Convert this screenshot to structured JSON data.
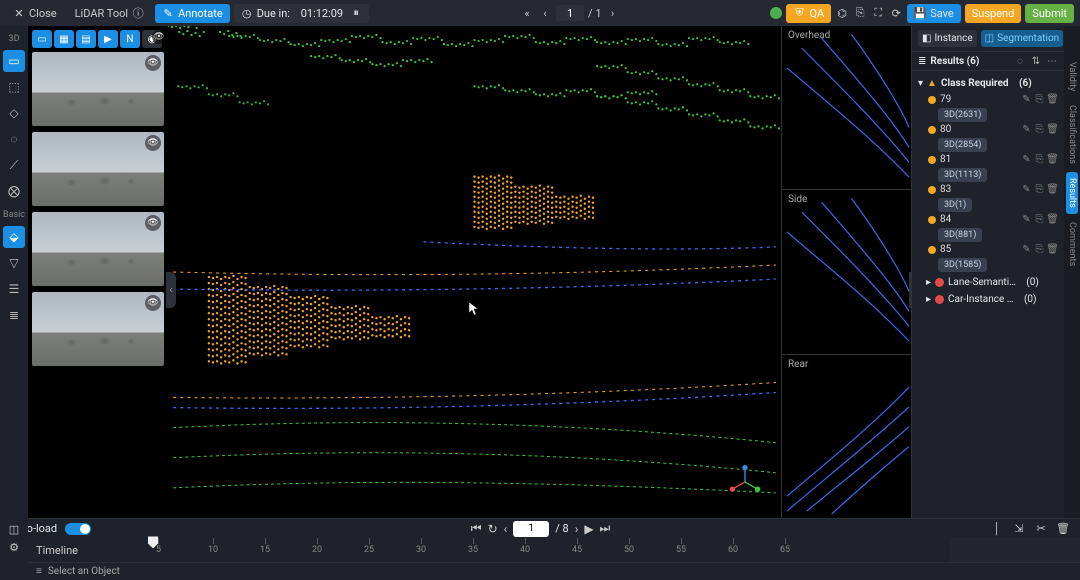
{
  "topbar": {
    "close": "Close",
    "tool": "LiDAR Tool",
    "annotate": "Annotate",
    "due_prefix": "Due in:",
    "due_value": "01:12:09",
    "page_current": "1",
    "page_total": "/ 1",
    "qa": "QA",
    "save": "Save",
    "suspend": "Suspend",
    "submit": "Submit"
  },
  "leftrail": {
    "label_3d": "3D",
    "label_basic": "Basic"
  },
  "viewer": {
    "overhead": "Overhead",
    "side": "Side",
    "rear": "Rear"
  },
  "right": {
    "tabs": {
      "instance": "Instance",
      "segmentation": "Segmentation"
    },
    "results_label": "Results",
    "results_count": "(6)",
    "class_required_label": "Class Required",
    "class_required_count": "(6)",
    "items": [
      {
        "id": "79",
        "sub": "3D(2631)",
        "color": "#f5a623"
      },
      {
        "id": "80",
        "sub": "3D(2854)",
        "color": "#f5a623"
      },
      {
        "id": "81",
        "sub": "3D(1113)",
        "color": "#f5a623"
      },
      {
        "id": "83",
        "sub": "3D(1)",
        "color": "#f5a623"
      },
      {
        "id": "84",
        "sub": "3D(881)",
        "color": "#f5a623"
      },
      {
        "id": "85",
        "sub": "3D(1585)",
        "color": "#f5a623"
      }
    ],
    "extra": [
      {
        "label": "Lane-Semanti…",
        "count": "(0)",
        "color": "#e24a4a"
      },
      {
        "label": "Car-Instance …",
        "count": "(0)",
        "color": "#e24a4a"
      }
    ],
    "rail": {
      "validity": "Validity",
      "classifications": "Classifications",
      "results": "Results",
      "comments": "Comments"
    }
  },
  "bottom": {
    "autoload": "Auto-load",
    "frame_input": "1",
    "frame_total": "/ 8",
    "timeline": "Timeline",
    "select_obj": "Select an Object",
    "ticks": [
      5,
      10,
      15,
      20,
      25,
      30,
      35,
      40,
      45,
      50,
      55,
      60,
      65
    ]
  }
}
